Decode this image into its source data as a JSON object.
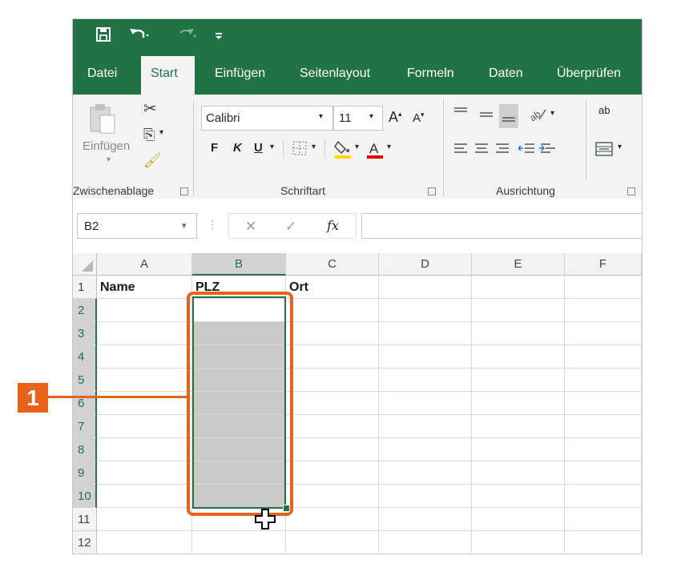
{
  "quick_access": {
    "save_icon": "save-icon",
    "undo_icon": "undo-icon",
    "redo_icon": "redo-icon",
    "customize_icon": "customize-qat-icon"
  },
  "tabs": [
    "Datei",
    "Start",
    "Einfügen",
    "Seitenlayout",
    "Formeln",
    "Daten",
    "Überprüfen"
  ],
  "active_tab": "Start",
  "ribbon": {
    "paste_label": "Einfügen",
    "font_name": "Calibri",
    "font_size": "11",
    "bold": "F",
    "italic": "K",
    "underline": "U",
    "wrap_text_label": "ab",
    "groups": {
      "clipboard": "Zwischenablage",
      "font": "Schriftart",
      "alignment": "Ausrichtung"
    }
  },
  "formula_bar": {
    "name_box": "B2",
    "cancel_symbol": "✕",
    "enter_symbol": "✓",
    "fx_label": "fx",
    "content": ""
  },
  "grid": {
    "columns": [
      "A",
      "B",
      "C",
      "D",
      "E",
      "F"
    ],
    "selected_column": "B",
    "rows": [
      "1",
      "2",
      "3",
      "4",
      "5",
      "6",
      "7",
      "8",
      "9",
      "10",
      "11",
      "12"
    ],
    "selected_rows": [
      "2",
      "3",
      "4",
      "5",
      "6",
      "7",
      "8",
      "9",
      "10"
    ],
    "cells": {
      "A1": "Name",
      "B1": "PLZ",
      "C1": "Ort"
    },
    "active_cell": "B2",
    "selection_range": "B2:B10"
  },
  "callout": {
    "number": "1",
    "color": "#e8621a"
  },
  "colors": {
    "excel_green": "#217346",
    "ribbon_bg": "#f3f3f3",
    "selection_fill": "#c9c9c9"
  }
}
